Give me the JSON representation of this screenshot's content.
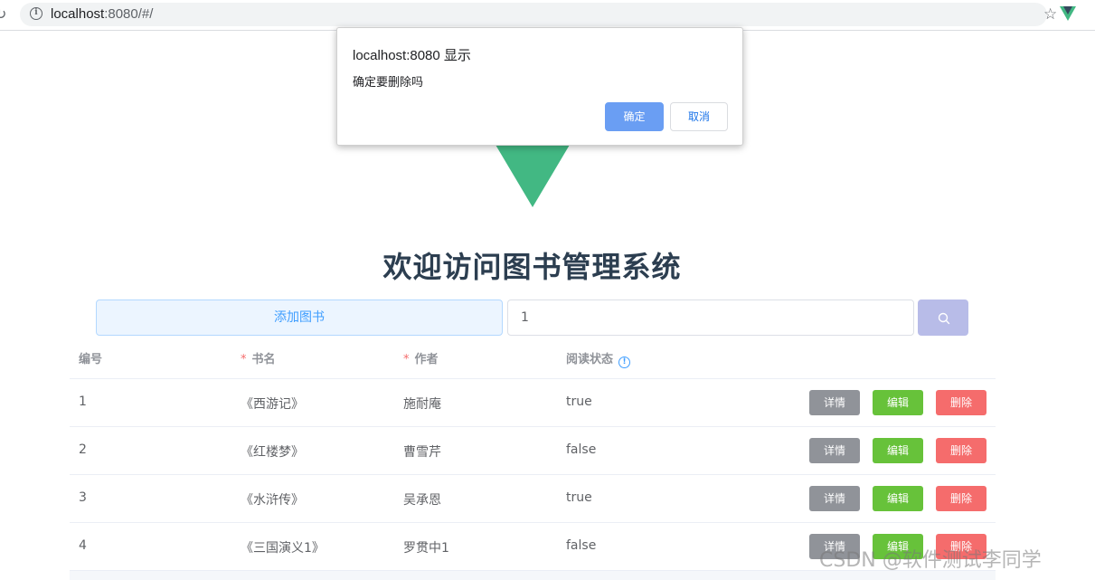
{
  "browser": {
    "url_host": "localhost",
    "url_rest": ":8080/#/"
  },
  "dialog": {
    "title": "localhost:8080 显示",
    "message": "确定要删除吗",
    "ok_label": "确定",
    "cancel_label": "取消"
  },
  "page": {
    "title": "欢迎访问图书管理系统"
  },
  "toolbar": {
    "add_label": "添加图书",
    "search_value": "1"
  },
  "table": {
    "columns": {
      "id": "编号",
      "name": "书名",
      "author": "作者",
      "status": "阅读状态"
    },
    "required_mark": "*",
    "rows": [
      {
        "id": "1",
        "name": "《西游记》",
        "author": "施耐庵",
        "status": "true",
        "detail": "详情",
        "edit": "编辑",
        "delete": "删除"
      },
      {
        "id": "2",
        "name": "《红楼梦》",
        "author": "曹雪芹",
        "status": "false",
        "detail": "详情",
        "edit": "编辑",
        "delete": "删除"
      },
      {
        "id": "3",
        "name": "《水浒传》",
        "author": "吴承恩",
        "status": "true",
        "detail": "详情",
        "edit": "编辑",
        "delete": "删除"
      },
      {
        "id": "4",
        "name": "《三国演义1》",
        "author": "罗贯中1",
        "status": "false",
        "detail": "详情",
        "edit": "编辑",
        "delete": "删除"
      }
    ]
  },
  "watermark": "CSDN @软件测试李同学",
  "icons": {
    "reload": "reload-icon",
    "info": "info-icon",
    "star": "star-icon",
    "vue_devtools": "vue-devtools-icon",
    "search": "search-icon",
    "question": "question-icon"
  },
  "colors": {
    "primary": "#409eff",
    "success": "#67c23a",
    "danger": "#f56c6c",
    "info": "#909399",
    "vue_green": "#42b883"
  }
}
